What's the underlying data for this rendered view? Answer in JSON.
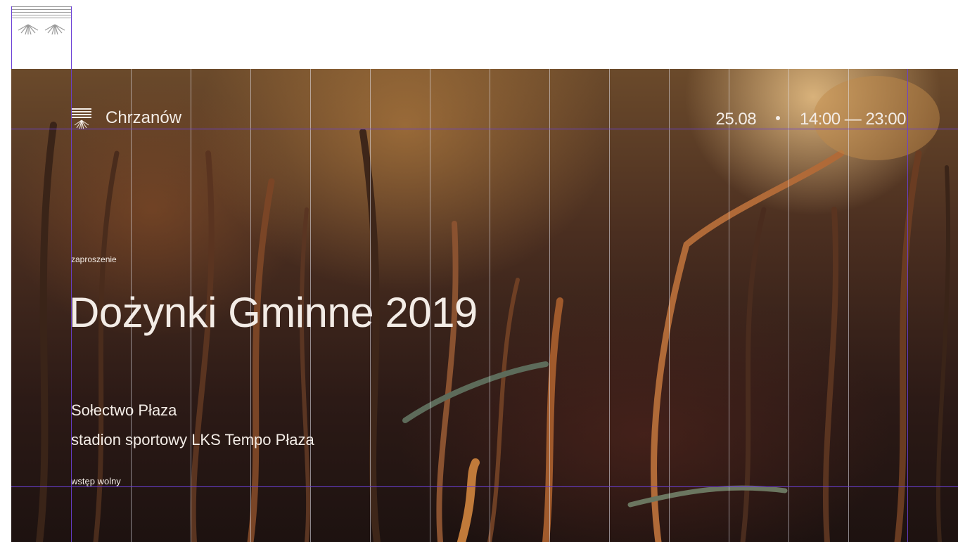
{
  "brand": {
    "name": "Chrzanów",
    "icon": "chrzanow-logo-icon"
  },
  "event": {
    "date": "25.08",
    "time": "14:00 — 23:00",
    "label": "zaproszenie",
    "title": "Dożynki Gminne 2019",
    "venue_line1": "Sołectwo Płaza",
    "venue_line2": "stadion sportowy LKS Tempo Płaza",
    "entry": "wstęp wolny"
  },
  "colors": {
    "guide": "#6a3fd6",
    "text": "#f3ece6"
  }
}
